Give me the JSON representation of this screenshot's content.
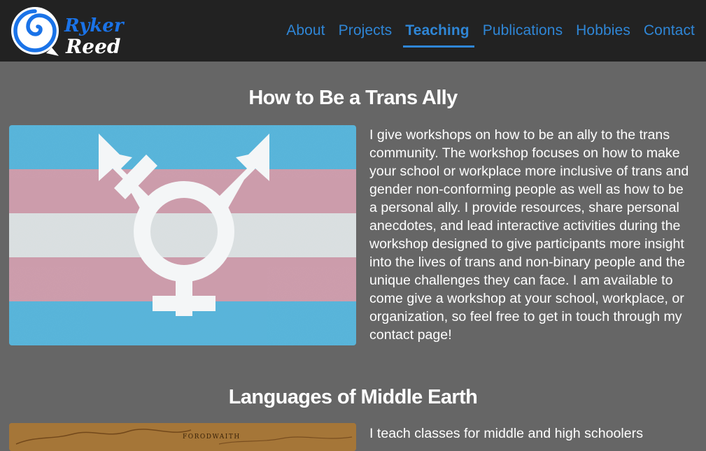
{
  "brand": {
    "name_line1": "Ryker",
    "name_line2": "Reed",
    "logo_icon": "spiral-shell-icon"
  },
  "nav": {
    "items": [
      {
        "label": "About"
      },
      {
        "label": "Projects"
      },
      {
        "label": "Teaching",
        "active": true
      },
      {
        "label": "Publications"
      },
      {
        "label": "Hobbies"
      },
      {
        "label": "Contact"
      }
    ]
  },
  "sections": [
    {
      "title": "How to Be a Trans Ally",
      "image": "transgender-flag-with-symbol-image",
      "text": "I give workshops on how to be an ally to the trans community. The workshop focuses on how to make your school or workplace more inclusive of trans and gender non-conforming people as well as how to be a personal ally. I provide resources, share personal anecdotes, and lead interactive activities during the workshop designed to give participants more insight into the lives of trans and non-binary people and the unique challenges they can face. I am available to come give a workshop at your school, workplace, or organization, so feel free to get in touch through my contact page!"
    },
    {
      "title": "Languages of Middle Earth",
      "image": "middle-earth-map-image",
      "map_label": "FORODWAITH",
      "text": "I teach classes for middle and high schoolers"
    }
  ],
  "colors": {
    "navbar_bg": "#222222",
    "page_bg": "#666666",
    "link": "#2f86d6",
    "flag_blue": "#55bde8",
    "flag_pink": "#d9a2b3",
    "flag_white": "#e8eef0"
  }
}
